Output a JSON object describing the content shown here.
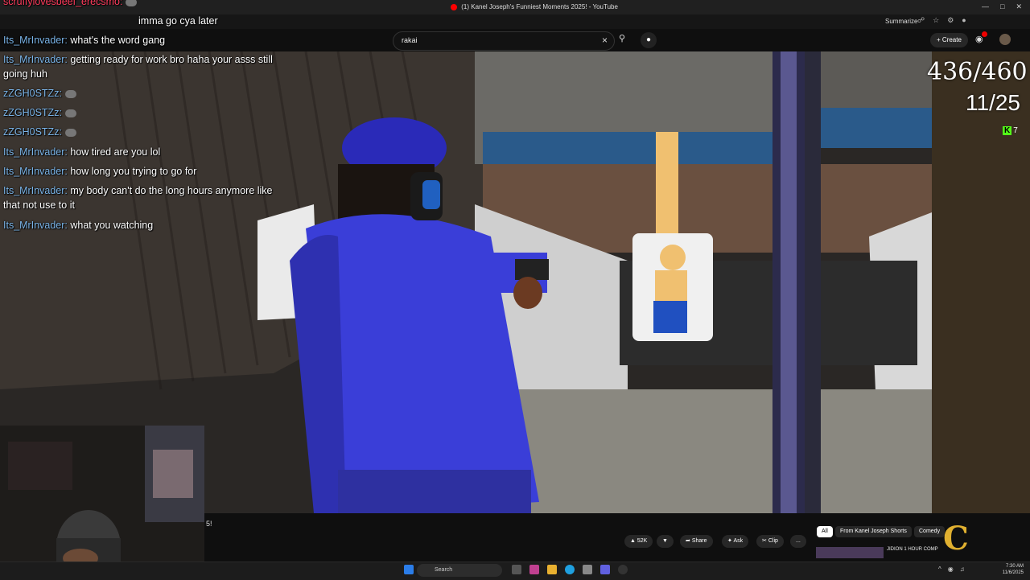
{
  "browser": {
    "tab_title": "(1) Kanel Joseph's Funniest Moments 2025! - YouTube",
    "summarize_label": "Summarize"
  },
  "youtube": {
    "search_value": "rakai",
    "create_label": "+ Create",
    "actions": {
      "like_count": "52K",
      "share_label": "Share",
      "ask_label": "Ask",
      "clip_label": "Clip",
      "more_label": "..."
    },
    "chips": [
      "All",
      "From Kanel Joseph Shorts",
      "Comedy"
    ],
    "rec_title": "JIDION 1 HOUR COMP"
  },
  "overlay": {
    "score_main": "436/460",
    "score_sub": "11/25",
    "kick_count": "7",
    "partial_text": "5!"
  },
  "chat": [
    {
      "user": "scruffylovesbeef_erecsmo:",
      "msg": "",
      "emote": true,
      "pink": true
    },
    {
      "user": "",
      "msg": "imma go cya later",
      "emote": false,
      "pink": false
    },
    {
      "user": "Its_MrInvader:",
      "msg": "what's the word gang",
      "emote": false,
      "pink": false
    },
    {
      "user": "Its_MrInvader:",
      "msg": "getting ready for work bro haha your asss still",
      "emote": false,
      "pink": false
    },
    {
      "user": "",
      "msg": "going huh",
      "emote": false,
      "pink": false
    },
    {
      "user": "zZGH0STZz:",
      "msg": "",
      "emote": true,
      "pink": false
    },
    {
      "user": "zZGH0STZz:",
      "msg": "",
      "emote": true,
      "pink": false
    },
    {
      "user": "zZGH0STZz:",
      "msg": "",
      "emote": true,
      "pink": false
    },
    {
      "user": "Its_MrInvader:",
      "msg": "how tired are you lol",
      "emote": false,
      "pink": false
    },
    {
      "user": "Its_MrInvader:",
      "msg": "how long you trying to go for",
      "emote": false,
      "pink": false
    },
    {
      "user": "Its_MrInvader:",
      "msg": "my body can't do the long hours anymore like",
      "emote": false,
      "pink": false
    },
    {
      "user": "",
      "msg": "that not use to it",
      "emote": false,
      "pink": false
    },
    {
      "user": "Its_MrInvader:",
      "msg": "what you watching",
      "emote": false,
      "pink": false
    }
  ],
  "taskbar": {
    "search_placeholder": "Search",
    "time": "7:30 AM",
    "date": "11/6/2025"
  },
  "colors": {
    "chat_user": "#7ab4e8",
    "chat_user_highlight": "#ff3b5c",
    "kick_green": "#53fc18",
    "police_uniform": "#3a3ed8"
  }
}
